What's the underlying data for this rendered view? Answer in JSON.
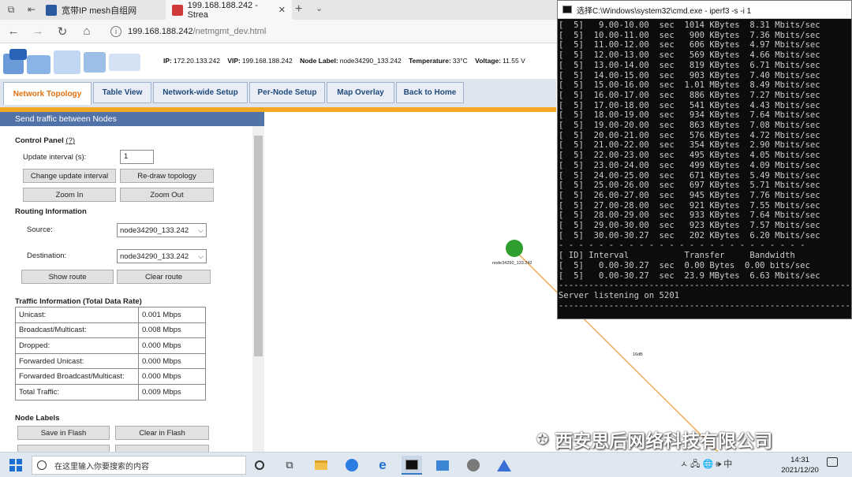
{
  "browser": {
    "tabs": [
      {
        "title": "宽带IP mesh自组网"
      },
      {
        "title": "199.168.188.242 - Strea"
      }
    ],
    "url_host": "199.168.188.242",
    "url_path": "/netmgmt_dev.html"
  },
  "header": {
    "ip_label": "IP:",
    "ip": "172.20.133.242",
    "vip_label": "VIP:",
    "vip": "199.168.188.242",
    "node_label_label": "Node Label:",
    "node_label": "node34290_133.242",
    "temperature_label": "Temperature:",
    "temperature": "33°C",
    "voltage_label": "Voltage:",
    "voltage": "11.55 V"
  },
  "nav_tabs": [
    "Network Topology",
    "Table View",
    "Network-wide Setup",
    "Per-Node Setup",
    "Map Overlay",
    "Back to Home"
  ],
  "send_traffic_label": "Send traffic between Nodes",
  "control_panel": {
    "title": "Control Panel",
    "help": "(?)",
    "update_interval_label": "Update interval (s):",
    "update_interval_value": "1",
    "change_update_interval": "Change update interval",
    "redraw_topology": "Re-draw topology",
    "zoom_in": "Zoom In",
    "zoom_out": "Zoom Out"
  },
  "routing": {
    "title": "Routing Information",
    "source_label": "Source:",
    "source_value": "node34290_133.242",
    "destination_label": "Destination:",
    "destination_value": "node34290_133.242",
    "show_route": "Show route",
    "clear_route": "Clear route"
  },
  "traffic": {
    "title": "Traffic Information (Total Data Rate)",
    "rows": [
      {
        "label": "Unicast:",
        "value": "0.001 Mbps"
      },
      {
        "label": "Broadcast/Multicast:",
        "value": "0.008 Mbps"
      },
      {
        "label": "Dropped:",
        "value": "0.000 Mbps"
      },
      {
        "label": "Forwarded Unicast:",
        "value": "0.000 Mbps"
      },
      {
        "label": "Forwarded Broadcast/Multicast:",
        "value": "0.000 Mbps"
      },
      {
        "label": "Total Traffic:",
        "value": "0.009 Mbps"
      }
    ]
  },
  "node_labels": {
    "title": "Node Labels",
    "save_in_flash": "Save in Flash",
    "clear_in_flash": "Clear in Flash"
  },
  "topology": {
    "node_label": "node34290_133.242",
    "link_label": "16dB",
    "node_color": "#2e9e2e",
    "link_color": "#f0b060"
  },
  "cmd": {
    "title": "选择C:\\Windows\\system32\\cmd.exe - iperf3  -s -i 1",
    "lines": [
      "[  5]   9.00-10.00  sec  1014 KBytes  8.31 Mbits/sec",
      "[  5]  10.00-11.00  sec   900 KBytes  7.36 Mbits/sec",
      "[  5]  11.00-12.00  sec   606 KBytes  4.97 Mbits/sec",
      "[  5]  12.00-13.00  sec   569 KBytes  4.66 Mbits/sec",
      "[  5]  13.00-14.00  sec   819 KBytes  6.71 Mbits/sec",
      "[  5]  14.00-15.00  sec   903 KBytes  7.40 Mbits/sec",
      "[  5]  15.00-16.00  sec  1.01 MBytes  8.49 Mbits/sec",
      "[  5]  16.00-17.00  sec   886 KBytes  7.27 Mbits/sec",
      "[  5]  17.00-18.00  sec   541 KBytes  4.43 Mbits/sec",
      "[  5]  18.00-19.00  sec   934 KBytes  7.64 Mbits/sec",
      "[  5]  19.00-20.00  sec   863 KBytes  7.08 Mbits/sec",
      "[  5]  20.00-21.00  sec   576 KBytes  4.72 Mbits/sec",
      "[  5]  21.00-22.00  sec   354 KBytes  2.90 Mbits/sec",
      "[  5]  22.00-23.00  sec   495 KBytes  4.05 Mbits/sec",
      "[  5]  23.00-24.00  sec   499 KBytes  4.09 Mbits/sec",
      "[  5]  24.00-25.00  sec   671 KBytes  5.49 Mbits/sec",
      "[  5]  25.00-26.00  sec   697 KBytes  5.71 Mbits/sec",
      "[  5]  26.00-27.00  sec   945 KBytes  7.76 Mbits/sec",
      "[  5]  27.00-28.00  sec   921 KBytes  7.55 Mbits/sec",
      "[  5]  28.00-29.00  sec   933 KBytes  7.64 Mbits/sec",
      "[  5]  29.00-30.00  sec   923 KBytes  7.57 Mbits/sec",
      "[  5]  30.00-30.27  sec   202 KBytes  6.20 Mbits/sec",
      "- - - - - - - - - - - - - - - - - - - - - - - - -",
      "[ ID] Interval           Transfer     Bandwidth",
      "[  5]   0.00-30.27  sec  0.00 Bytes  0.00 bits/sec",
      "[  5]   0.00-30.27  sec  23.9 MBytes  6.63 Mbits/sec",
      "-----------------------------------------------------------",
      "Server listening on 5201",
      "-----------------------------------------------------------"
    ]
  },
  "taskbar": {
    "search_placeholder": "在这里输入你要搜索的内容",
    "tray_text": "ㅅ 🖧 🌐 🕪 中",
    "time": "14:31",
    "date": "2021/12/20"
  },
  "watermark": "西安思后网络科技有限公司"
}
